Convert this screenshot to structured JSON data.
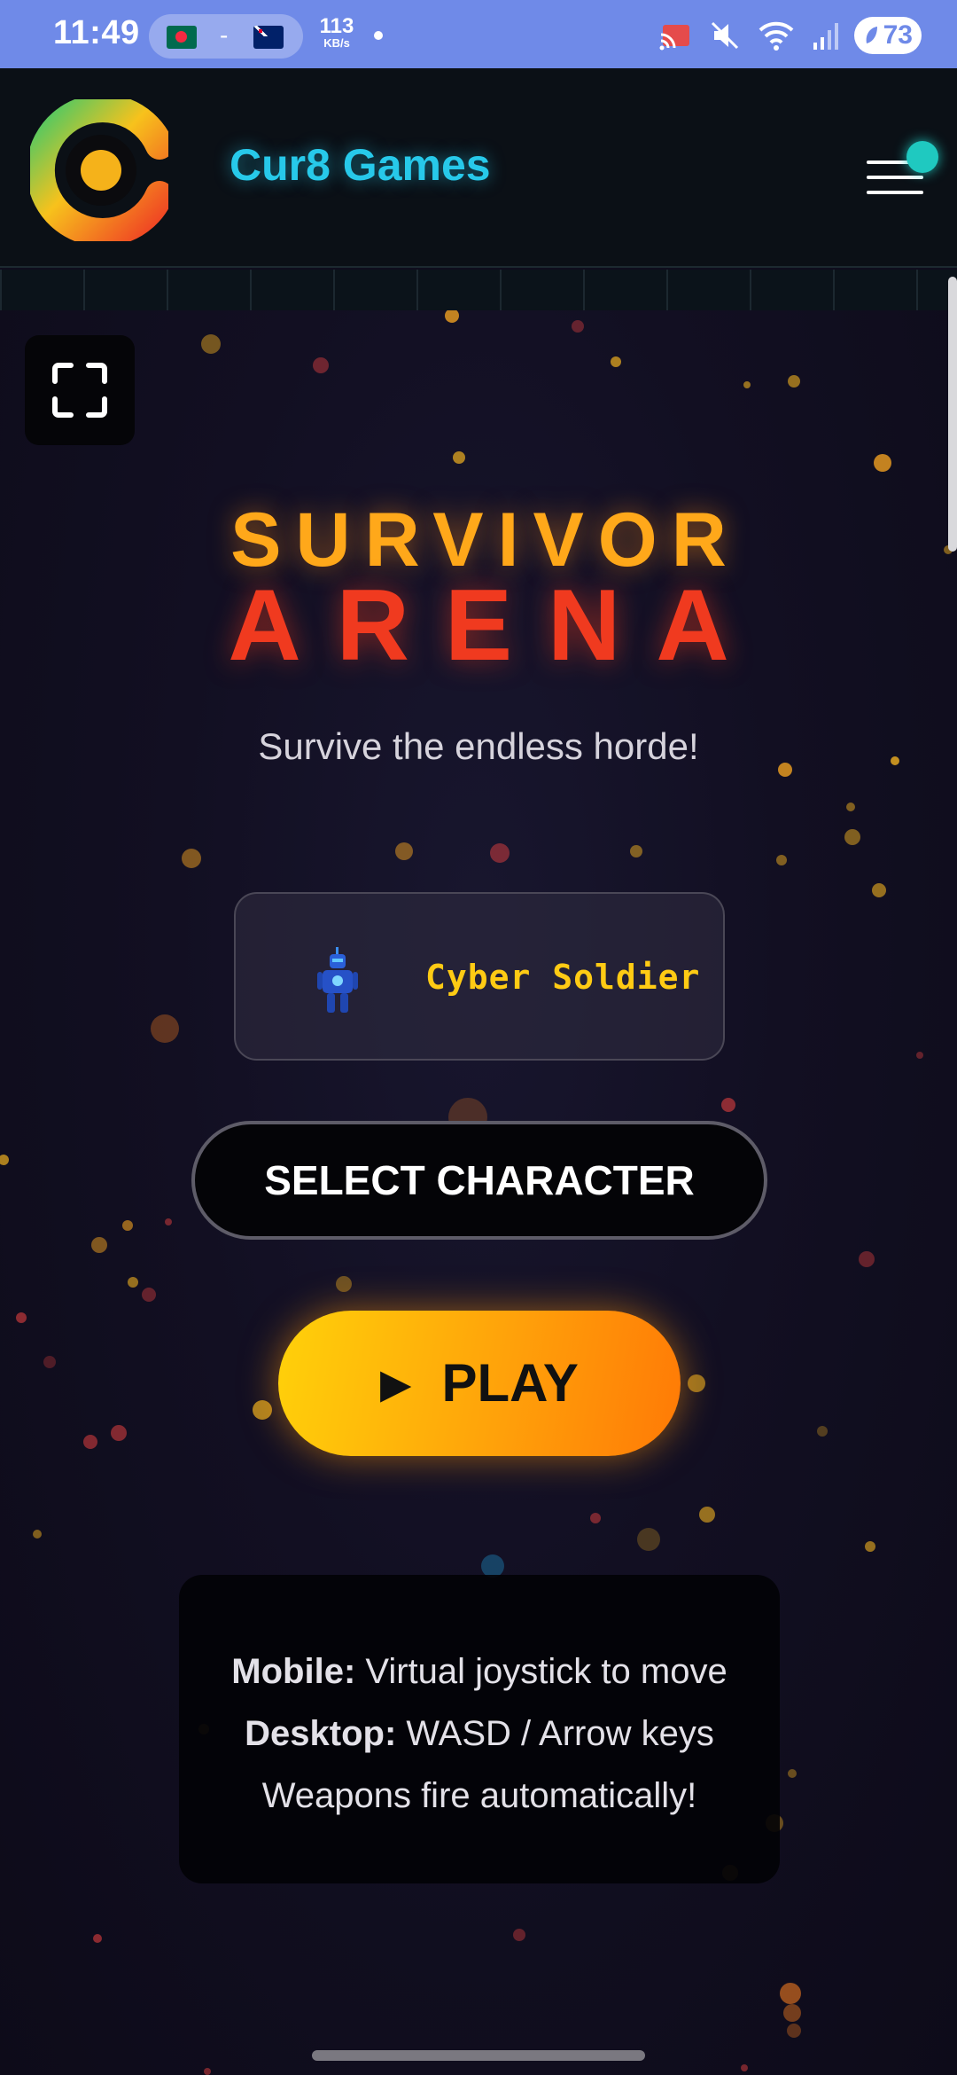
{
  "status_bar": {
    "time": "11:49",
    "pill_separator": "-",
    "net_speed_value": "113",
    "net_speed_unit": "KB/s",
    "battery_level": "73",
    "icons": [
      "cast-icon",
      "mute-icon",
      "wifi-icon",
      "signal-icon",
      "battery-icon"
    ],
    "color": "#6f8ae8"
  },
  "header": {
    "brand": "Cur8 Games",
    "brand_color": "#27c9ea",
    "logo_icon": "cur8-logo",
    "menu_icon": "hamburger-menu-icon"
  },
  "game": {
    "title_line1": "SURVIVOR",
    "title_line2": "ARENA",
    "subtitle": "Survive the endless horde!",
    "character": {
      "name": "Cyber Soldier",
      "icon": "cyber-soldier-sprite"
    },
    "select_character_label": "SELECT CHARACTER",
    "play_icon": "▶",
    "play_label": "PLAY",
    "instructions": [
      {
        "label": "Mobile:",
        "text": " Virtual joystick to move"
      },
      {
        "label": "Desktop:",
        "text": " WASD / Arrow keys"
      },
      {
        "label": "",
        "text": "Weapons fire automatically!"
      }
    ],
    "colors": {
      "title_top": "#ffa81a",
      "title_bottom": "#f03a1f",
      "character_name": "#ffcb14",
      "play_gradient_start": "#ffd10a",
      "play_gradient_end": "#ff7a06"
    }
  }
}
